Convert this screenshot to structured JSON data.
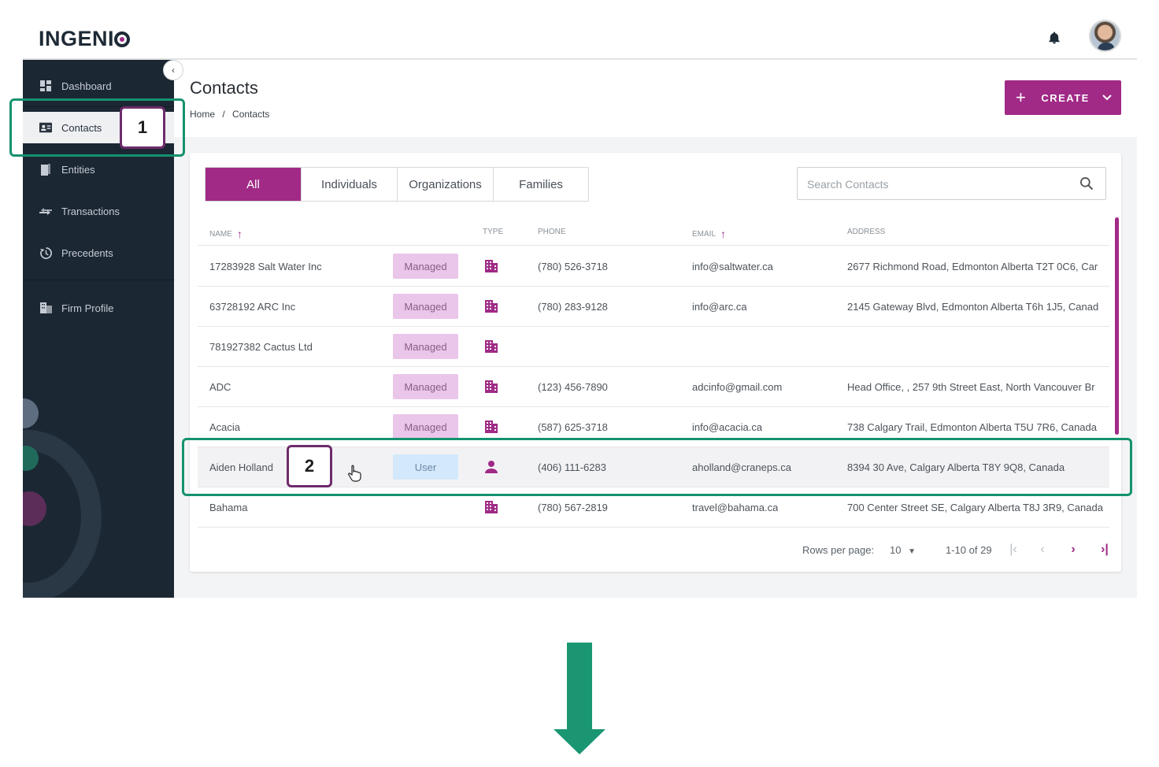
{
  "app": {
    "logo": "INGENIO"
  },
  "sidebar": {
    "items": [
      {
        "label": "Dashboard",
        "icon": "dashboard-icon"
      },
      {
        "label": "Contacts",
        "icon": "contact-card-icon"
      },
      {
        "label": "Entities",
        "icon": "entities-icon"
      },
      {
        "label": "Transactions",
        "icon": "transactions-icon"
      },
      {
        "label": "Precedents",
        "icon": "history-icon"
      },
      {
        "label": "Firm Profile",
        "icon": "building-icon"
      }
    ],
    "active_index": 1
  },
  "page": {
    "title": "Contacts",
    "breadcrumb": [
      "Home",
      "/",
      "Contacts"
    ]
  },
  "toolbar": {
    "create_label": "CREATE"
  },
  "tabs": [
    "All",
    "Individuals",
    "Organizations",
    "Families"
  ],
  "search": {
    "placeholder": "Search Contacts"
  },
  "table": {
    "headers": {
      "name": "NAME",
      "type": "TYPE",
      "phone": "PHONE",
      "email": "EMAIL",
      "address": "ADDRESS"
    },
    "rows": [
      {
        "name": "17283928 Salt Water Inc",
        "badge": "Managed",
        "type": "organization",
        "phone": "(780) 526-3718",
        "email": "info@saltwater.ca",
        "address": "2677 Richmond Road, Edmonton Alberta T2T 0C6, Car"
      },
      {
        "name": "63728192 ARC Inc",
        "badge": "Managed",
        "type": "organization",
        "phone": "(780) 283-9128",
        "email": "info@arc.ca",
        "address": "2145 Gateway Blvd, Edmonton Alberta T6h 1J5, Canad"
      },
      {
        "name": "781927382 Cactus Ltd",
        "badge": "Managed",
        "type": "organization",
        "phone": "",
        "email": "",
        "address": ""
      },
      {
        "name": "ADC",
        "badge": "Managed",
        "type": "organization",
        "phone": "(123) 456-7890",
        "email": "adcinfo@gmail.com",
        "address": "Head Office, , 257 9th Street East, North Vancouver Br"
      },
      {
        "name": "Acacia",
        "badge": "Managed",
        "type": "organization",
        "phone": "(587) 625-3718",
        "email": "info@acacia.ca",
        "address": "738 Calgary Trail, Edmonton Alberta T5U 7R6, Canada"
      },
      {
        "name": "Aiden Holland",
        "badge": "User",
        "type": "person",
        "phone": "(406) 111-6283",
        "email": "aholland@craneps.ca",
        "address": "8394 30 Ave, Calgary Alberta T8Y 9Q8, Canada"
      },
      {
        "name": "Bahama",
        "badge": "",
        "type": "organization",
        "phone": "(780) 567-2819",
        "email": "travel@bahama.ca",
        "address": "700 Center Street SE, Calgary Alberta T8J 3R9, Canada"
      }
    ]
  },
  "pagination": {
    "rows_label": "Rows per page:",
    "rows_value": "10",
    "range": "1-10 of 29"
  },
  "annotations": {
    "step1": "1",
    "step2": "2"
  },
  "colors": {
    "brand": "#a02a86",
    "sidebar": "#1c2734",
    "annotation_green": "#15926f",
    "annotation_purple": "#6e2b6b"
  }
}
